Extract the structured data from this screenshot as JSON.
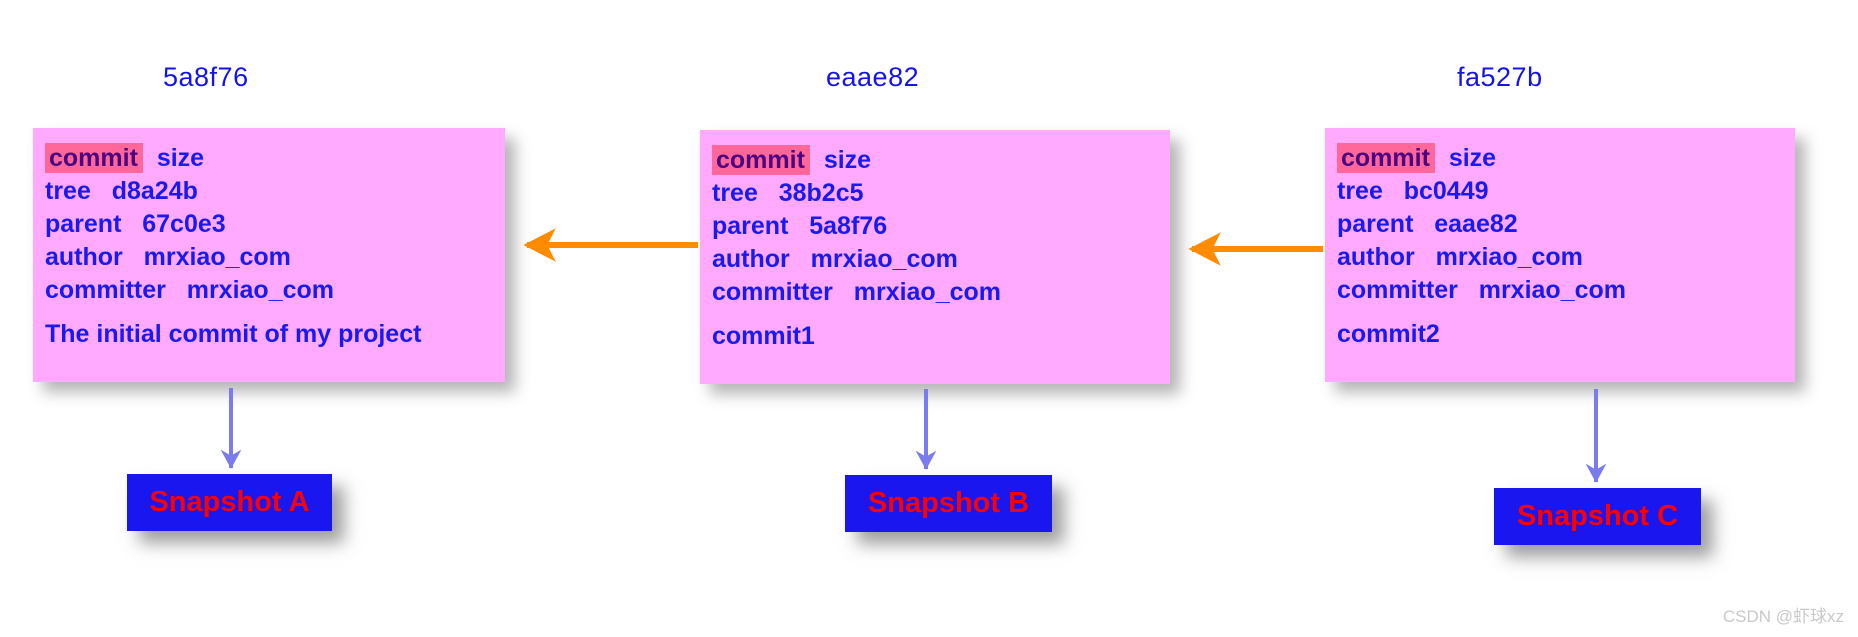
{
  "diagram": {
    "title_hashes": [
      "5a8f76",
      "eaae82",
      "fa527b"
    ],
    "colors": {
      "commit_box_bg": "#ffaaff",
      "highlight_bg": "#ff6699",
      "text_blue": "#1a1aee",
      "highlight_text": "#4b0082",
      "arrow_orange": "#ff8c00",
      "snapshot_bg": "#1a16f0",
      "snapshot_text": "#ff0000",
      "down_arrow": "#7b7bf0"
    }
  },
  "commits": [
    {
      "hash_label": "5a8f76",
      "header_keyword": "commit",
      "header_size": "size",
      "fields": [
        {
          "key": "tree",
          "value": "d8a24b"
        },
        {
          "key": "parent",
          "value": "67c0e3"
        },
        {
          "key": "author",
          "value": "mrxiao_com"
        },
        {
          "key": "committer",
          "value": "mrxiao_com"
        }
      ],
      "message": "The initial commit of my project"
    },
    {
      "hash_label": "eaae82",
      "header_keyword": "commit",
      "header_size": "size",
      "fields": [
        {
          "key": "tree",
          "value": "38b2c5"
        },
        {
          "key": "parent",
          "value": "5a8f76"
        },
        {
          "key": "author",
          "value": "mrxiao_com"
        },
        {
          "key": "committer",
          "value": "mrxiao_com"
        }
      ],
      "message": "commit1"
    },
    {
      "hash_label": "fa527b",
      "header_keyword": "commit",
      "header_size": "size",
      "fields": [
        {
          "key": "tree",
          "value": "bc0449"
        },
        {
          "key": "parent",
          "value": "eaae82"
        },
        {
          "key": "author",
          "value": "mrxiao_com"
        },
        {
          "key": "committer",
          "value": "mrxiao_com"
        }
      ],
      "message": "commit2"
    }
  ],
  "snapshots": [
    {
      "label": "Snapshot A"
    },
    {
      "label": "Snapshot B"
    },
    {
      "label": "Snapshot C"
    }
  ],
  "watermark": {
    "text": "CSDN @虾球xz"
  }
}
